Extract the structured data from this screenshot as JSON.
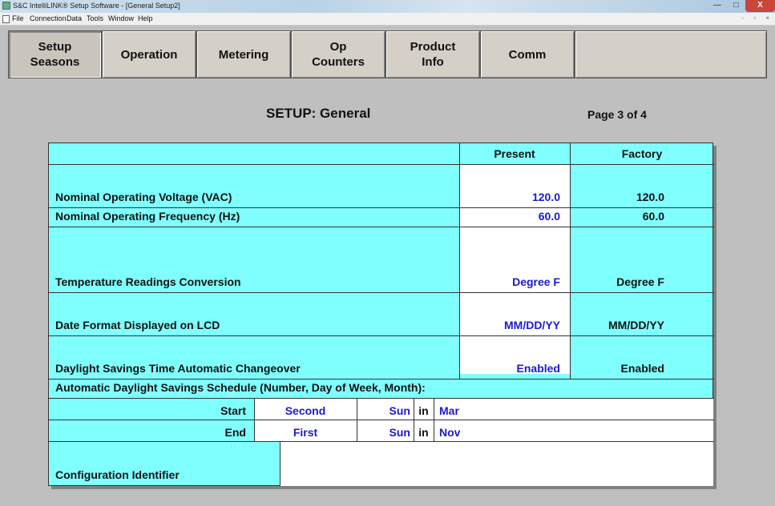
{
  "window": {
    "title": "S&C IntelliLINK® Setup Software - [General Setup2]",
    "controls": [
      "—",
      "□",
      "X"
    ]
  },
  "menu": [
    "File",
    "Connection",
    "Data",
    "Tools",
    "Window",
    "Help"
  ],
  "mdi_controls": "- ▫ ×",
  "tabs": [
    {
      "label": "Setup\nSeasons",
      "active": true
    },
    {
      "label": "Operation"
    },
    {
      "label": "Metering"
    },
    {
      "label": "Op\nCounters"
    },
    {
      "label": "Product\nInfo"
    },
    {
      "label": "Comm"
    },
    {
      "label": ""
    }
  ],
  "heading": "SETUP: General",
  "page_indicator": "Page 3 of 4",
  "columns": {
    "present": "Present",
    "factory": "Factory"
  },
  "rows": [
    {
      "label": "Nominal Operating Voltage (VAC)",
      "present": "120.0",
      "factory": "120.0"
    },
    {
      "label": "Nominal Operating Frequency (Hz)",
      "present": "60.0",
      "factory": "60.0"
    },
    {
      "label": "Temperature Readings Conversion",
      "present": "Degree F",
      "factory": "Degree F"
    },
    {
      "label": "Date Format Displayed on LCD",
      "present": "MM/DD/YY",
      "factory": "MM/DD/YY"
    },
    {
      "label": "Daylight Savings Time Automatic Changeover",
      "present": "Enabled",
      "factory": "Enabled"
    }
  ],
  "dst_schedule": {
    "header": "Automatic Daylight Savings Schedule (Number, Day of Week, Month):",
    "start": {
      "label": "Start",
      "number": "Second",
      "day": "Sun",
      "in": "in",
      "month": "Mar"
    },
    "end": {
      "label": "End",
      "number": "First",
      "day": "Sun",
      "in": "in",
      "month": "Nov"
    }
  },
  "config_identifier": {
    "label": "Configuration Identifier",
    "value": ""
  },
  "colors": {
    "panel": "#80ffff",
    "value_blue": "#1a1ad0",
    "background": "#bfbfbf"
  }
}
